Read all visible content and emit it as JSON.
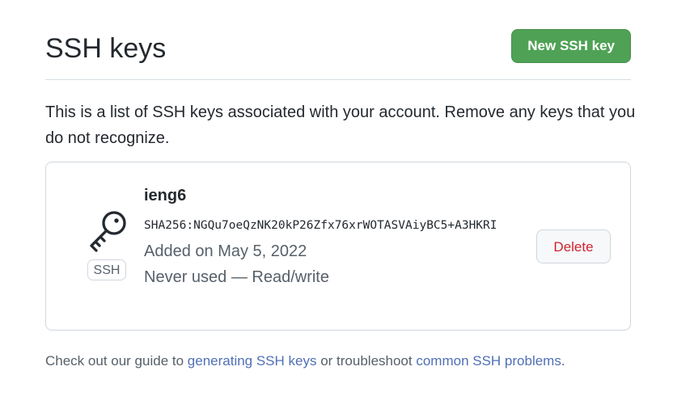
{
  "header": {
    "title": "SSH keys",
    "new_key_label": "New SSH key"
  },
  "intro": "This is a list of SSH keys associated with your account. Remove any keys that you do not recognize.",
  "key": {
    "title": "ieng6",
    "fingerprint": "SHA256:NGQu7oeQzNK20kP26Zfx76xrWOTASVAiyBC5+A3HKRI",
    "badge": "SSH",
    "added": "Added on May 5, 2022",
    "usage": "Never used — Read/write",
    "delete_label": "Delete",
    "icon": "key-icon"
  },
  "footer": {
    "text_before": "Check out our guide to ",
    "link_generating": "generating SSH keys",
    "text_middle": " or troubleshoot ",
    "link_problems": "common SSH problems",
    "text_after": "."
  },
  "colors": {
    "primary_button": "#4fa255",
    "danger_text": "#cf222e",
    "link": "#4f6fb6",
    "muted_text": "#57606a",
    "border": "#d0d7de"
  }
}
